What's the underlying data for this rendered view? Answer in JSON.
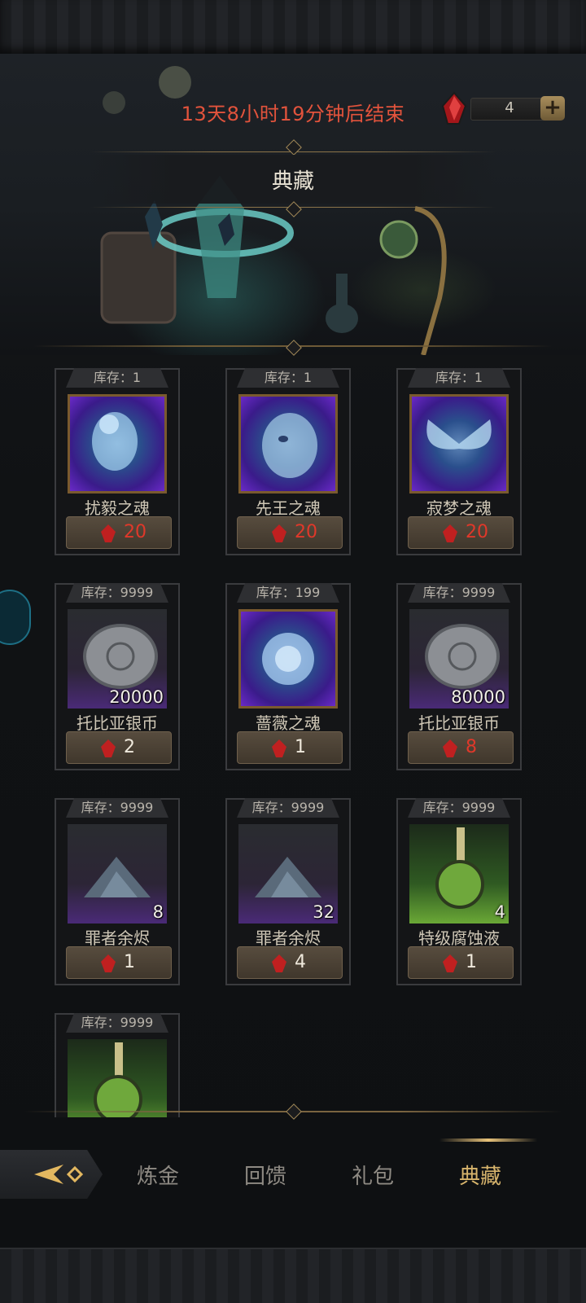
{
  "header": {
    "timer_text": "13天8小时19分钟后结束",
    "currency_amount": "4",
    "plus_label": "+",
    "title": "典藏"
  },
  "items": [
    {
      "stock": "库存：1",
      "name": "扰毅之魂",
      "price": "20",
      "icon": "soul-doll-icon",
      "qty": "",
      "price_color": "red"
    },
    {
      "stock": "库存：1",
      "name": "先王之魂",
      "price": "20",
      "icon": "soul-king-face-icon",
      "qty": "",
      "price_color": "red"
    },
    {
      "stock": "库存：1",
      "name": "寂梦之魂",
      "price": "20",
      "icon": "soul-butterfly-icon",
      "qty": "",
      "price_color": "red"
    },
    {
      "stock": "库存：9999",
      "name": "托比亚银币",
      "price": "2",
      "icon": "silver-coin-icon",
      "qty": "20000",
      "price_color": "white"
    },
    {
      "stock": "库存：199",
      "name": "蔷薇之魂",
      "price": "1",
      "icon": "soul-rose-icon",
      "qty": "",
      "price_color": "white"
    },
    {
      "stock": "库存：9999",
      "name": "托比亚银币",
      "price": "8",
      "icon": "silver-coin-icon",
      "qty": "80000",
      "price_color": "red"
    },
    {
      "stock": "库存：9999",
      "name": "罪者余烬",
      "price": "1",
      "icon": "ember-pile-icon",
      "qty": "8",
      "price_color": "white"
    },
    {
      "stock": "库存：9999",
      "name": "罪者余烬",
      "price": "4",
      "icon": "ember-pile-icon",
      "qty": "32",
      "price_color": "white"
    },
    {
      "stock": "库存：9999",
      "name": "特级腐蚀液",
      "price": "1",
      "icon": "corrosion-potion-icon",
      "qty": "4",
      "price_color": "white"
    },
    {
      "stock": "库存：9999",
      "name": "",
      "price": "",
      "icon": "corrosion-potion-icon",
      "qty": "",
      "price_color": "white"
    }
  ],
  "nav": {
    "tabs": [
      "炼金",
      "回馈",
      "礼包",
      "典藏"
    ],
    "active_index": 3
  },
  "colors": {
    "timer": "#e2533c",
    "price_red": "#e0382a",
    "active_tab": "#d7b46c",
    "gold_trim": "#8c7449"
  }
}
